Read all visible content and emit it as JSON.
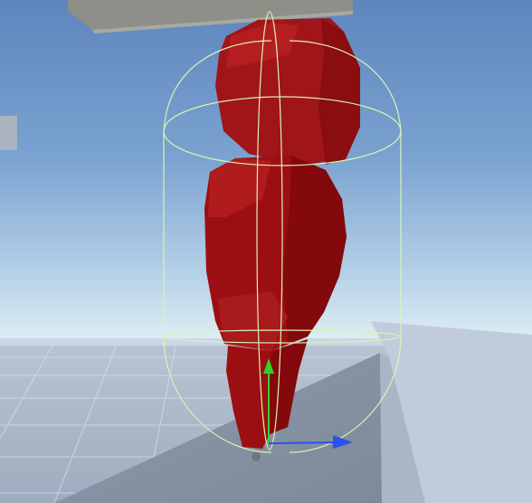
{
  "scene": {
    "sky_top_color": "#5e86be",
    "sky_horizon_color": "#dcecf3",
    "ground_color": "#a7b5c8",
    "ground_grid_color": "#d9e3ef",
    "platform_top_color": "#c0cbdc",
    "platform_front_color": "#8c99aa",
    "character_color": "#9b0f12",
    "collider_color": "#d8f5b0",
    "gizmo_y_color": "#33d12b",
    "gizmo_z_color": "#2b52e8",
    "icons": [
      "capsule-collider-gizmo",
      "move-gizmo-y-arrow",
      "move-gizmo-z-arrow"
    ]
  }
}
